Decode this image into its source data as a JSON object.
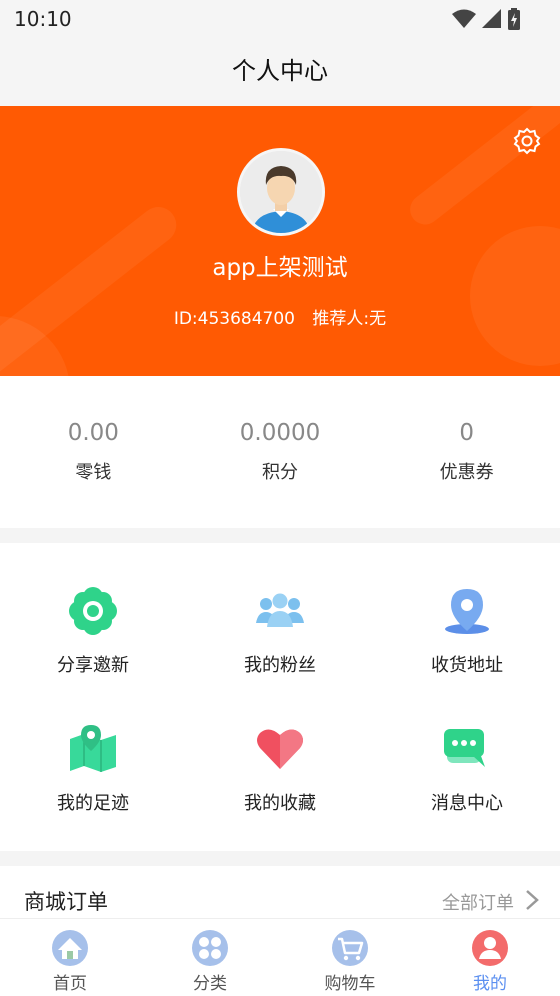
{
  "status_bar": {
    "time": "10:10"
  },
  "header": {
    "title": "个人中心"
  },
  "profile": {
    "username": "app上架测试",
    "id_text": "ID:453684700",
    "referrer_text": "推荐人:无"
  },
  "stats": [
    {
      "value": "0.00",
      "label": "零钱"
    },
    {
      "value": "0.0000",
      "label": "积分"
    },
    {
      "value": "0",
      "label": "优惠券"
    }
  ],
  "services": [
    {
      "label": "分享邀新",
      "icon": "share-invite-icon"
    },
    {
      "label": "我的粉丝",
      "icon": "fans-icon"
    },
    {
      "label": "收货地址",
      "icon": "address-pin-icon"
    },
    {
      "label": "我的足迹",
      "icon": "map-footprint-icon"
    },
    {
      "label": "我的收藏",
      "icon": "heart-icon"
    },
    {
      "label": "消息中心",
      "icon": "chat-bubble-icon"
    }
  ],
  "orders": {
    "title": "商城订单",
    "all_label": "全部订单"
  },
  "tabbar": [
    {
      "label": "首页",
      "icon": "home-icon"
    },
    {
      "label": "分类",
      "icon": "category-icon"
    },
    {
      "label": "购物车",
      "icon": "cart-icon"
    },
    {
      "label": "我的",
      "icon": "profile-icon",
      "active": true
    }
  ],
  "colors": {
    "brand": "#ff5a03",
    "active_tab": "#5b8ff0",
    "green": "#2fd38a",
    "blue": "#78aaf0",
    "red": "#f05060"
  }
}
